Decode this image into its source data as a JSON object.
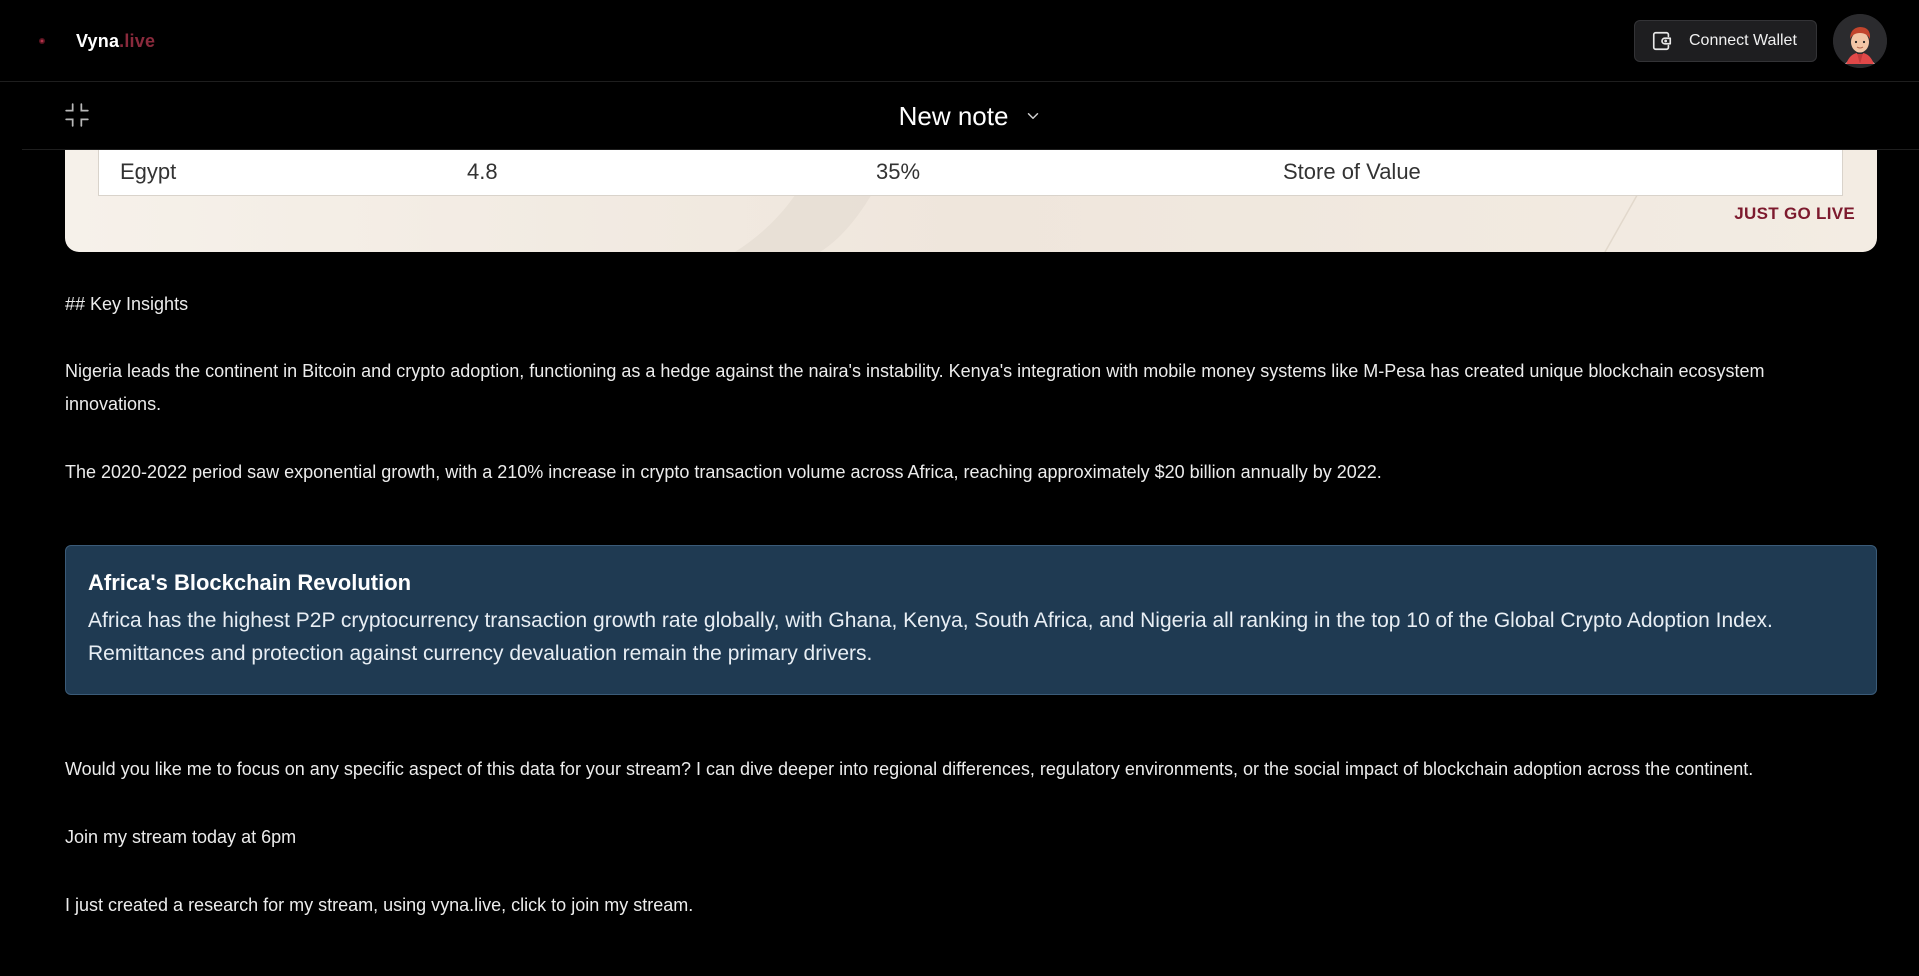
{
  "header": {
    "brand_main": "Vyna",
    "brand_accent": ".live",
    "connect_wallet_label": "Connect Wallet"
  },
  "note": {
    "title": "New note"
  },
  "card": {
    "row": {
      "country": "Egypt",
      "value": "4.8",
      "percent": "35%",
      "use_case": "Store of Value"
    },
    "cta": "JUST GO LIVE"
  },
  "content": {
    "heading_md": "## Key Insights",
    "paragraph1_line1": "Nigeria leads the continent in Bitcoin and crypto adoption, functioning as a hedge against the naira's instability. Kenya's integration with mobile money systems like M-Pesa has created unique blockchain ecosystem",
    "paragraph1_line2": "innovations.",
    "paragraph2": "The 2020-2022 period saw exponential growth, with a 210% increase in crypto transaction volume across Africa, reaching approximately $20 billion annually by 2022.",
    "callout_title": "Africa's Blockchain Revolution",
    "callout_line1": "Africa has the highest P2P cryptocurrency transaction growth rate globally, with Ghana, Kenya, South Africa, and Nigeria all ranking in the top 10 of the Global Crypto Adoption Index.",
    "callout_line2": "Remittances and protection against currency devaluation remain the primary drivers.",
    "paragraph3": "Would you like me to focus on any specific aspect of this data for your stream? I can dive deeper into regional differences, regulatory environments, or the social impact of blockchain adoption across the continent.",
    "paragraph4": "Join my stream today at 6pm",
    "paragraph5": "I just created a research for my stream, using vyna.live, click to join my stream."
  },
  "colors": {
    "background": "#000000",
    "brand_accent": "#8a2a3c",
    "callout_bg": "#1f3a52",
    "cta": "#7d1a2e"
  },
  "icons": [
    "vyna-logo-icon",
    "wallet-icon",
    "user-avatar",
    "collapse-icon",
    "chevron-down-icon"
  ]
}
